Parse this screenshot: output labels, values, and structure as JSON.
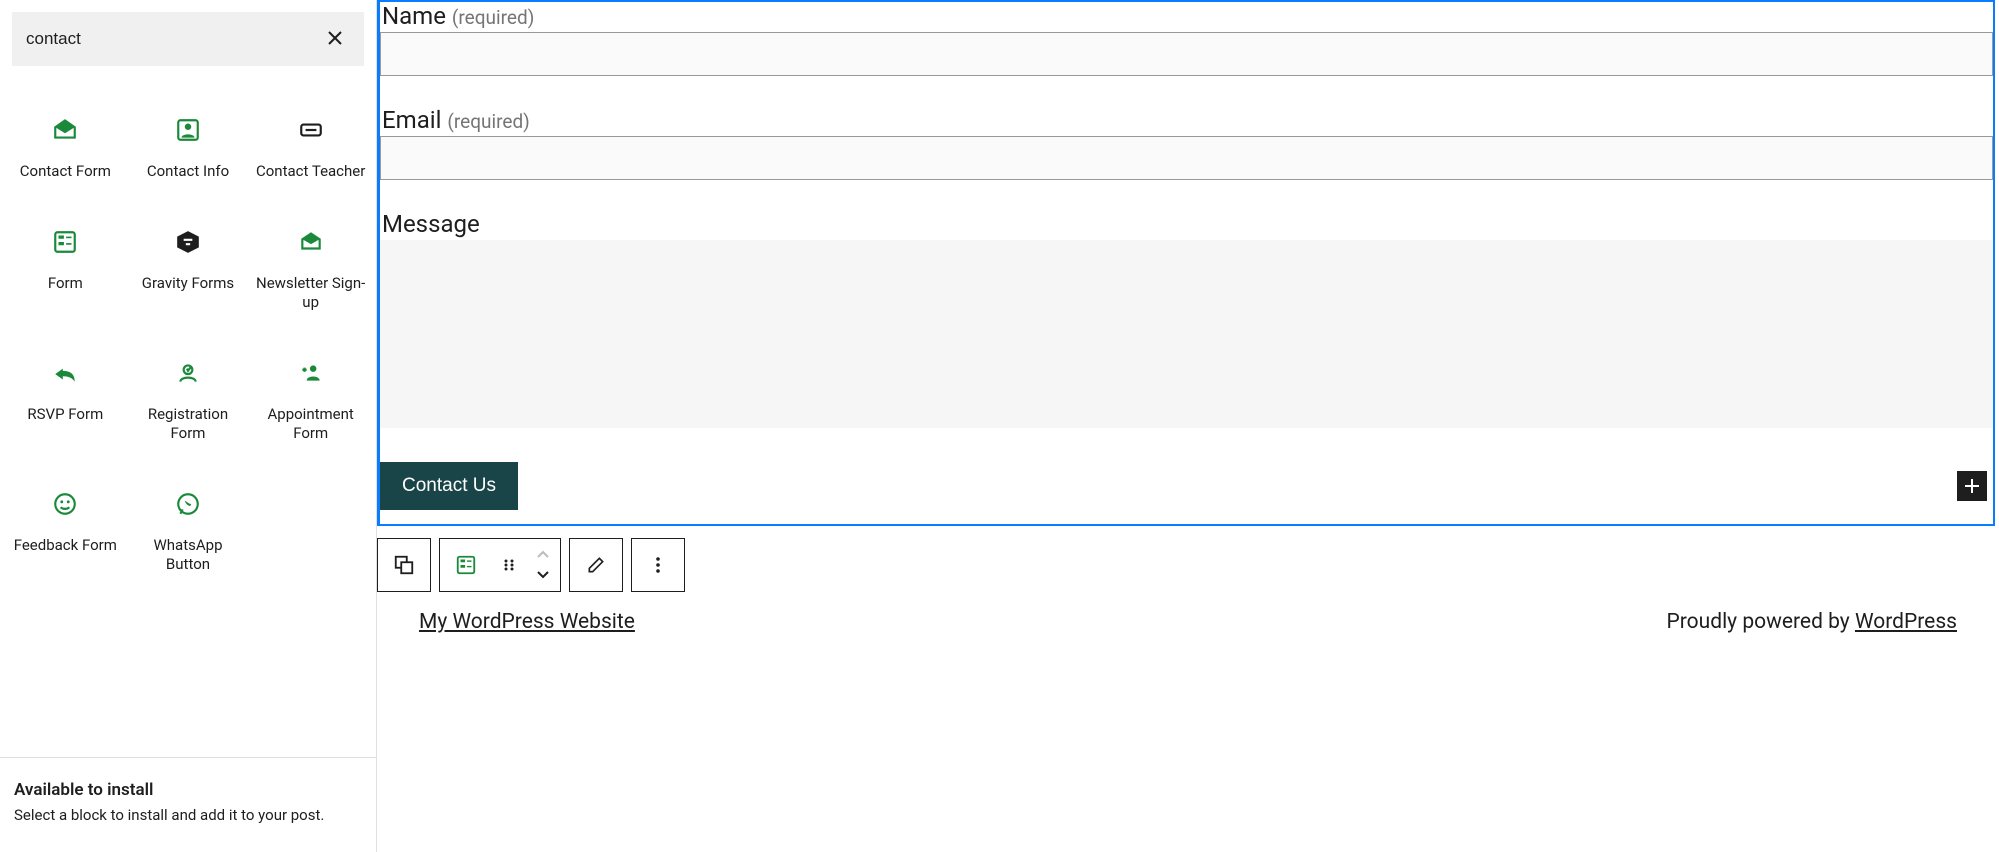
{
  "sidebar": {
    "search_value": "contact",
    "blocks": [
      {
        "label": "Contact Form"
      },
      {
        "label": "Contact Info"
      },
      {
        "label": "Contact Teacher"
      },
      {
        "label": "Form"
      },
      {
        "label": "Gravity Forms"
      },
      {
        "label": "Newsletter Sign-up"
      },
      {
        "label": "RSVP Form"
      },
      {
        "label": "Registration Form"
      },
      {
        "label": "Appointment Form"
      },
      {
        "label": "Feedback Form"
      },
      {
        "label": "WhatsApp Button"
      }
    ],
    "footer_title": "Available to install",
    "footer_sub": "Select a block to install and add it to your post."
  },
  "form": {
    "name_label": "Name",
    "name_required": "(required)",
    "email_label": "Email",
    "email_required": "(required)",
    "message_label": "Message",
    "submit_label": "Contact Us"
  },
  "page_footer": {
    "site_title": "My WordPress Website",
    "powered_prefix": "Proudly powered by ",
    "powered_link": "WordPress"
  }
}
